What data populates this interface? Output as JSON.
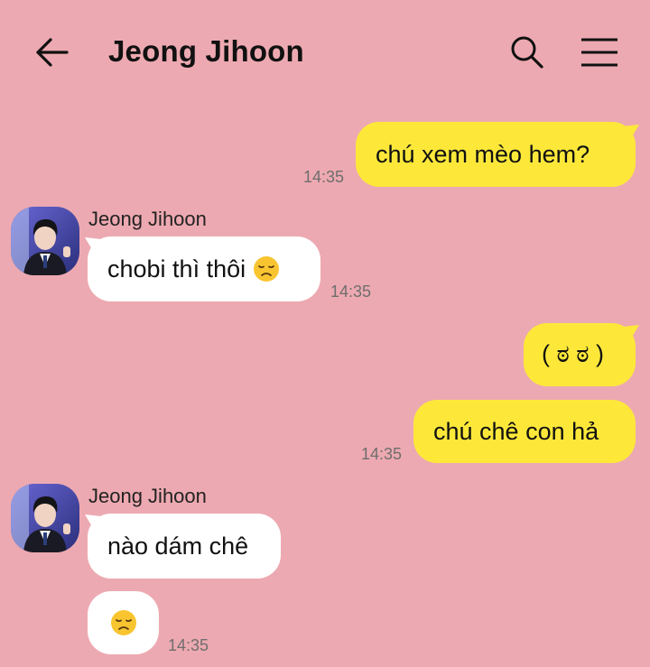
{
  "header": {
    "title": "Jeong Jihoon",
    "back_icon": "arrow-left-icon",
    "search_icon": "search-icon",
    "menu_icon": "hamburger-menu-icon"
  },
  "colors": {
    "background": "#eda9b1",
    "outgoing_bubble": "#fde83a",
    "incoming_bubble": "#ffffff",
    "timestamp": "#6e6e6e"
  },
  "messages": [
    {
      "direction": "out",
      "text": "chú xem mèo hem?",
      "time": "14:35"
    },
    {
      "direction": "in",
      "sender": "Jeong Jihoon",
      "text": "chobi thì thôi",
      "emoji": "disappointed-face-icon",
      "time": "14:35"
    },
    {
      "direction": "out",
      "text": "( ಠ ಠ )"
    },
    {
      "direction": "out",
      "text": "chú chê con hả",
      "time": "14:35"
    },
    {
      "direction": "in",
      "sender": "Jeong Jihoon",
      "text": "nào dám chê"
    },
    {
      "direction": "in",
      "text": "",
      "emoji": "disappointed-face-icon",
      "time": "14:35"
    }
  ]
}
